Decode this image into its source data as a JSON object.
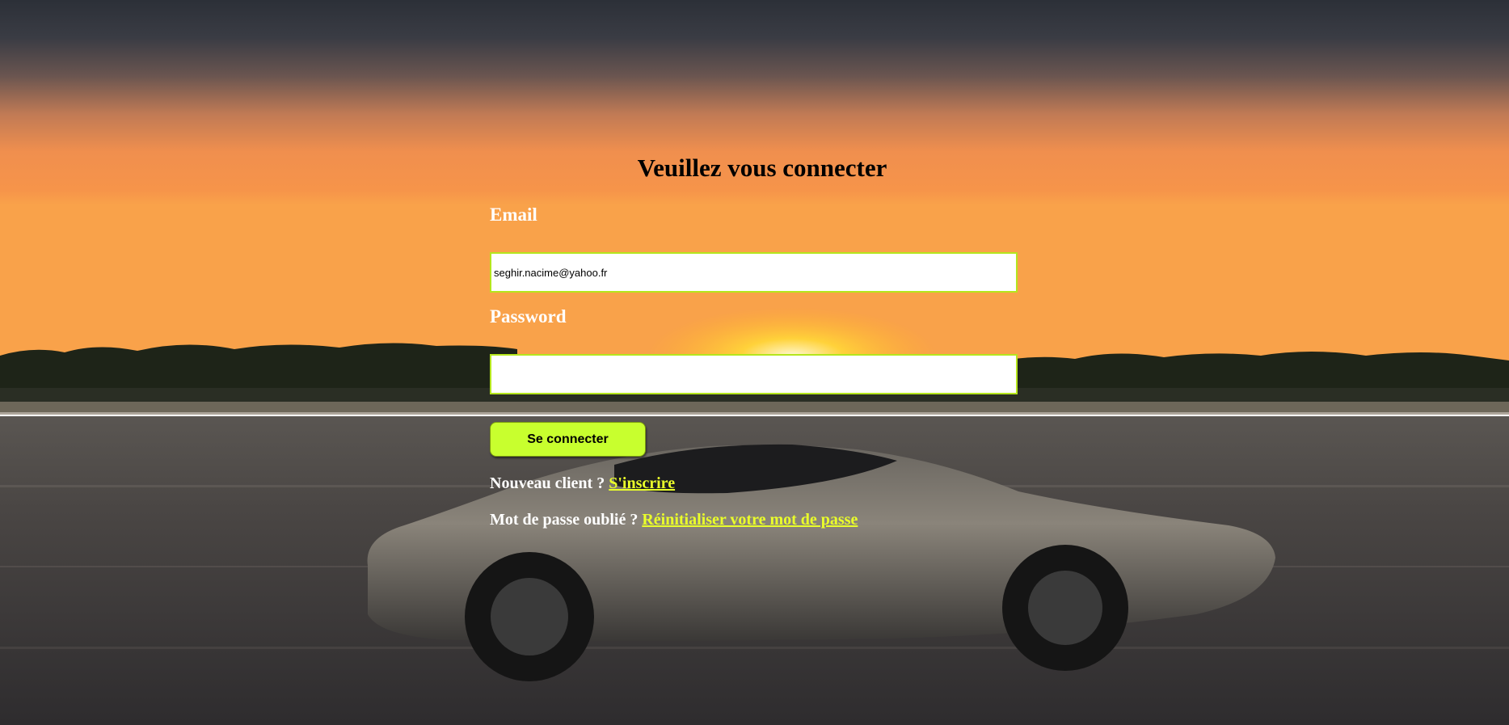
{
  "login": {
    "title": "Veuillez vous connecter",
    "email_label": "Email",
    "email_value": "seghir.nacime@yahoo.fr",
    "password_label": "Password",
    "password_value": "",
    "submit_label": "Se connecter",
    "signup_prompt": "Nouveau client ? ",
    "signup_link": "S'inscrire",
    "reset_prompt": "Mot de passe oublié ? ",
    "reset_link": "Réinitialiser votre mot de passe"
  },
  "colors": {
    "accent": "#c8ff2e",
    "link": "#eaff2a",
    "input_border": "#b5e61d"
  },
  "background": {
    "icon": "sports-car-sunset-background"
  }
}
